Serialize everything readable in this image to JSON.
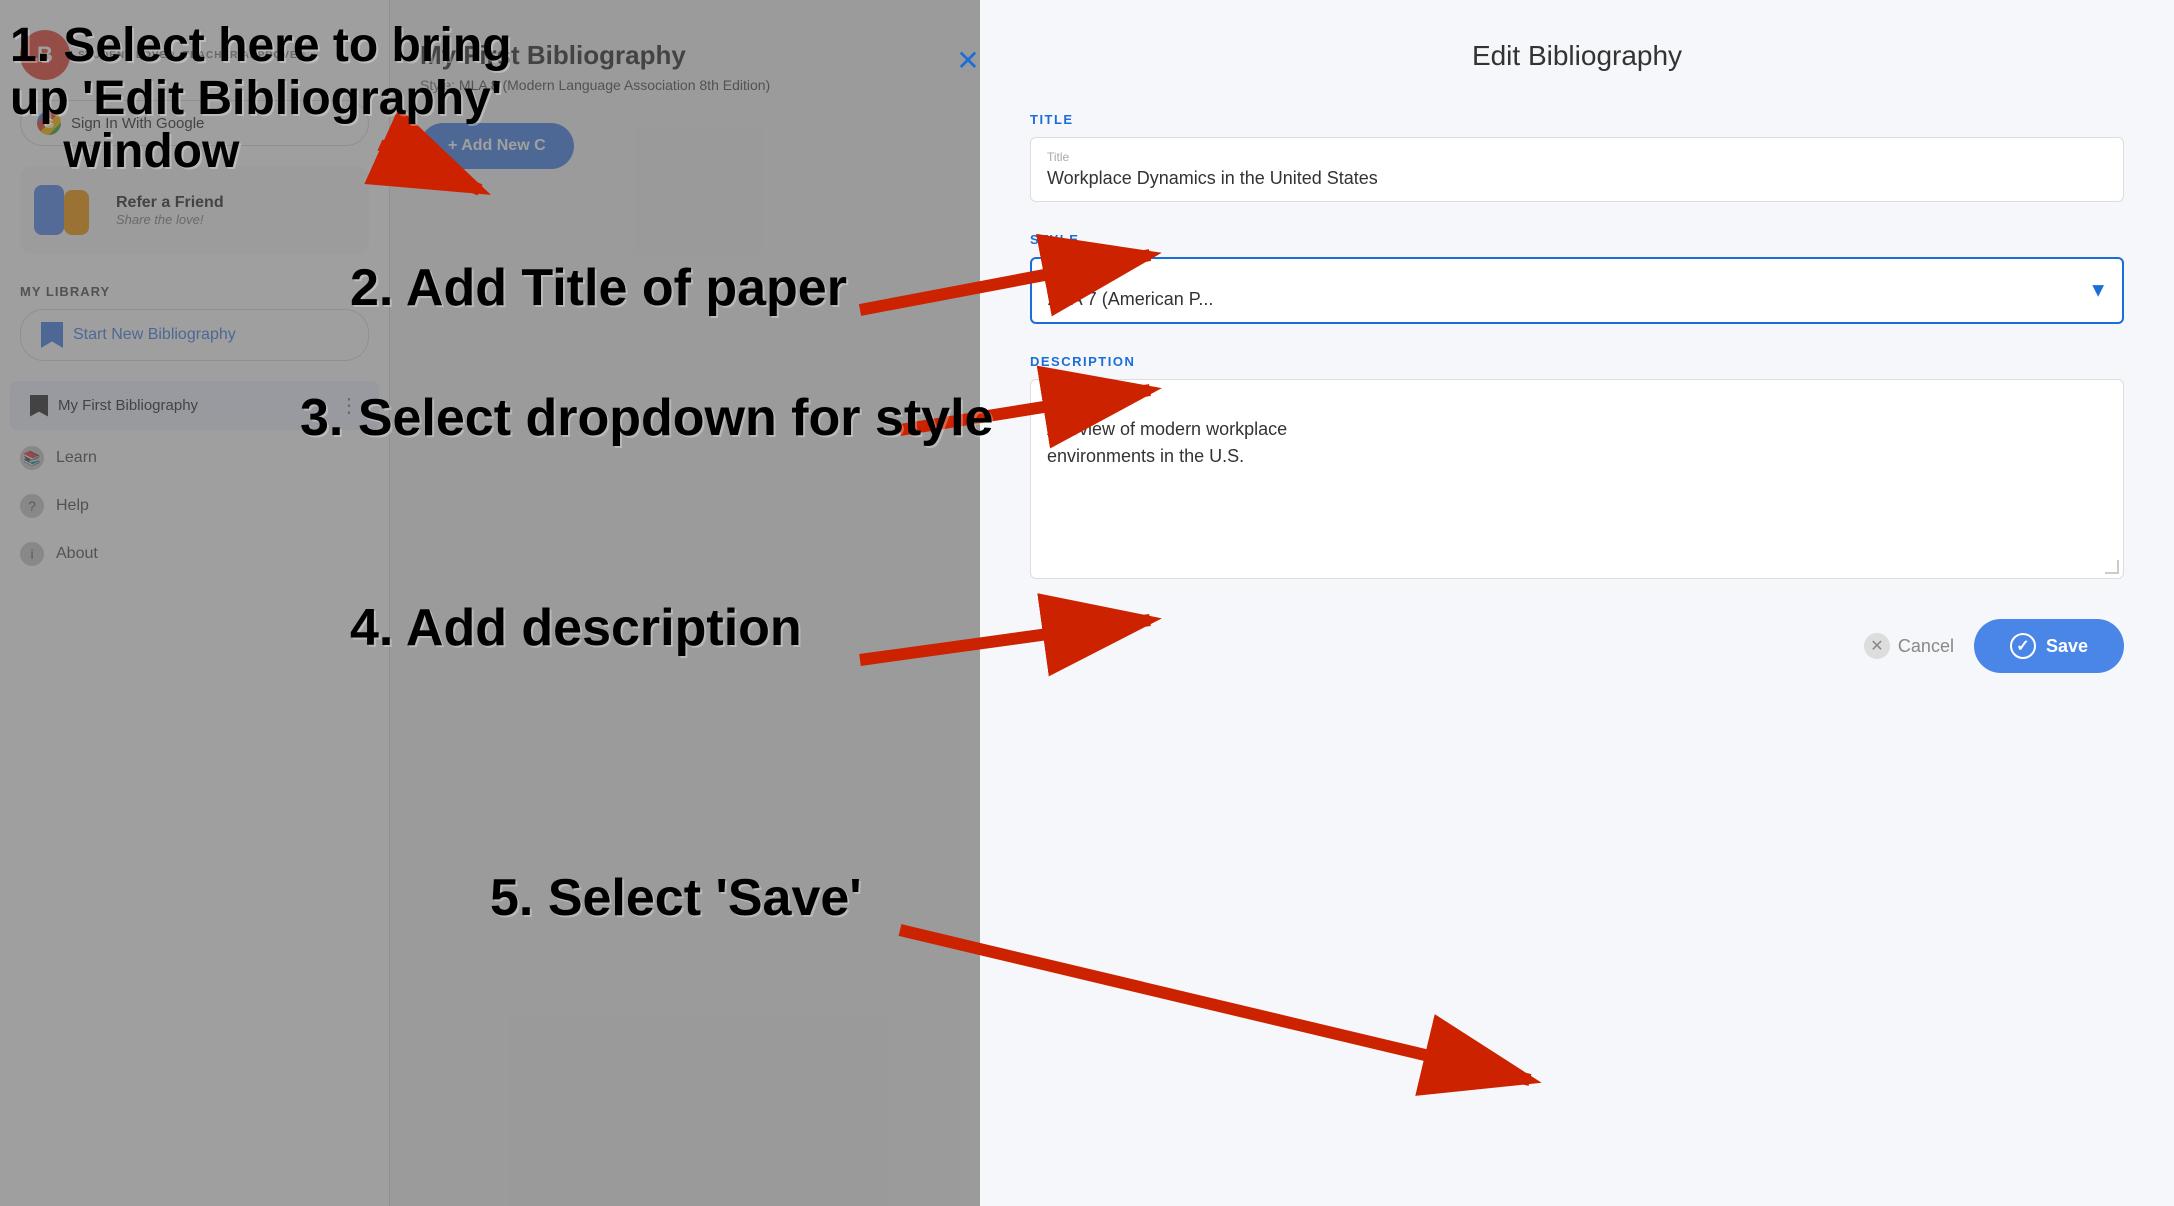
{
  "app": {
    "title": "Edit Bibliography",
    "tagline": "STUDENT LOVED. TEACHER APPROVED."
  },
  "sidebar": {
    "google_signin": "Sign In With Google",
    "refer_friend_title": "Refer a Friend",
    "refer_friend_sub": "Share the love!",
    "my_library_label": "MY LIBRARY",
    "start_new_label": "Start New Bibliography",
    "bib_item_name": "My First Bibliography",
    "nav_learn": "Learn",
    "nav_help": "Help",
    "nav_about": "About"
  },
  "main": {
    "bib_title": "My First Bibliography",
    "bib_style": "MLA 8 (Modern Language Association 8th Edition)",
    "add_new_label": "+ Add New C"
  },
  "edit_panel": {
    "title": "Edit Bibliography",
    "section_title": "TITLE",
    "title_placeholder": "Title",
    "title_value": "Workplace Dynamics in the United States",
    "section_style": "STYLE",
    "style_placeholder": "Style",
    "style_value": "APA 7 (American P...",
    "section_description": "DESCRIPTION",
    "desc_placeholder": "Description",
    "desc_value": "A review of modern workplace\nenvironments in the U.S.",
    "cancel_label": "Cancel",
    "save_label": "Save"
  },
  "annotations": {
    "step1": "1. Select here to bring up  'Edit Bibliography'\n    window",
    "step2": "2.  Add Title of paper",
    "step3": "3.  Select dropdown for style",
    "step4": "4.  Add description",
    "step5": "5.  Select 'Save'"
  },
  "colors": {
    "accent_blue": "#4a86e8",
    "label_blue": "#1a6ed8",
    "red_arrow": "#cc2200",
    "close_x": "#1a6ed8"
  }
}
